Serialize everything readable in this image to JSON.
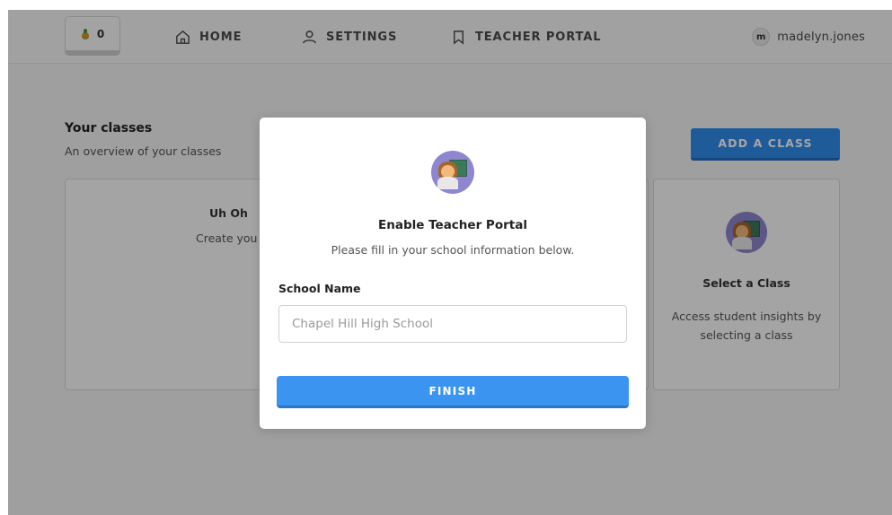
{
  "nav": {
    "coin_count": "0",
    "home_label": "HOME",
    "settings_label": "SETTINGS",
    "teacher_portal_label": "TEACHER PORTAL",
    "user_initial": "m",
    "username": "madelyn.jones"
  },
  "main": {
    "title": "Your classes",
    "subtitle": "An overview of your classes",
    "add_class_label": "ADD A CLASS",
    "empty_card": {
      "heading": "Uh Oh",
      "text": "Create you"
    },
    "select_card": {
      "title": "Select a Class",
      "description": "Access student insights by selecting a class"
    }
  },
  "modal": {
    "title": "Enable Teacher Portal",
    "subtitle": "Please fill in your school information below.",
    "field_label": "School Name",
    "school_input_placeholder": "Chapel Hill High School",
    "finish_label": "FINISH"
  },
  "colors": {
    "primary_blue": "#3b95f0",
    "avatar_purple": "#8e86cf",
    "overlay": "rgba(0,0,0,0.35)"
  }
}
